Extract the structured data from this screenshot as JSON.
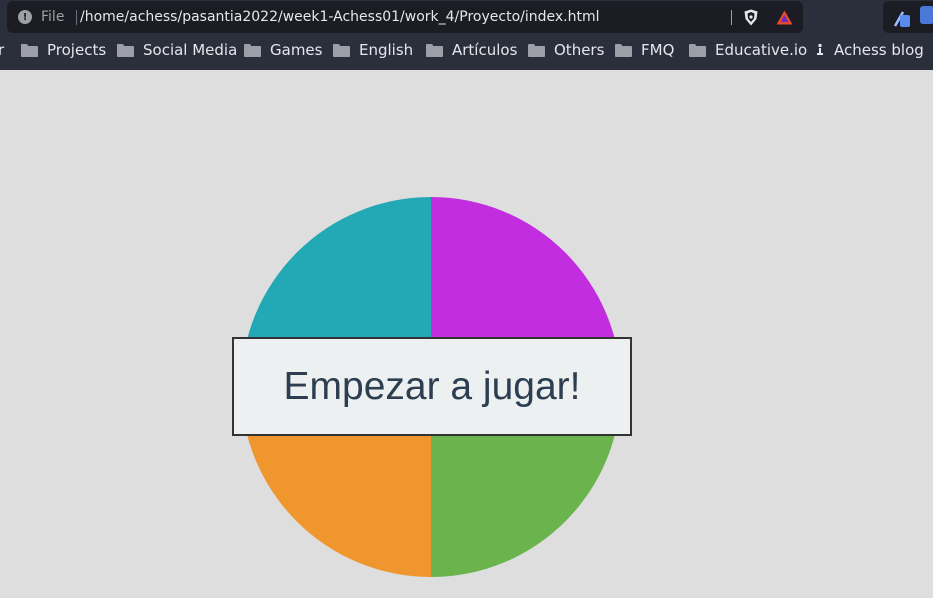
{
  "browser": {
    "file_label": "File",
    "url": "/home/achess/pasantia2022/week1-Achess01/work_4/Proyecto/index.html"
  },
  "bookmarks": {
    "cut_item": "r",
    "items": [
      {
        "label": "Projects",
        "icon": "folder-icon"
      },
      {
        "label": "Social Media",
        "icon": "folder-icon"
      },
      {
        "label": "Games",
        "icon": "folder-icon"
      },
      {
        "label": "English",
        "icon": "folder-icon"
      },
      {
        "label": "Artículos",
        "icon": "folder-icon"
      },
      {
        "label": "Others",
        "icon": "folder-icon"
      },
      {
        "label": "FMQ",
        "icon": "folder-icon"
      },
      {
        "label": "Educative.io",
        "icon": "folder-icon"
      },
      {
        "label": "Achess blog",
        "icon": "page-icon"
      }
    ]
  },
  "game": {
    "start_label": "Empezar a jugar!",
    "colors": {
      "top_left": "#23a8b6",
      "top_right": "#c22de0",
      "bottom_left": "#f0962f",
      "bottom_right": "#6ab34d"
    }
  }
}
